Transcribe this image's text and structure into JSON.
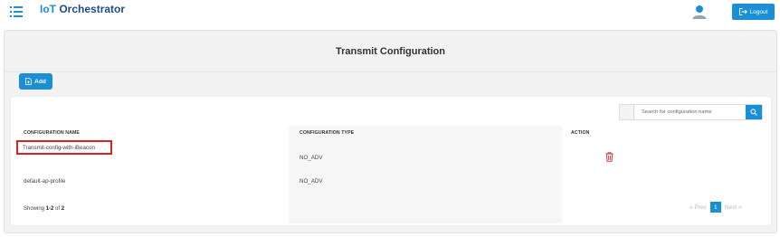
{
  "header": {
    "app_title_prefix": "IoT",
    "app_title_rest": "Orchestrator",
    "logout_label": "Logout"
  },
  "page": {
    "title": "Transmit Configuration",
    "add_label": "Add"
  },
  "search": {
    "placeholder": "Search for configuration name"
  },
  "table": {
    "columns": [
      "CONFIGURATION NAME",
      "CONFIGURATION TYPE",
      "ACTION"
    ],
    "rows": [
      {
        "name": "Transmit-config-with-iBeacon",
        "type": "NO_ADV"
      },
      {
        "name": "default-ap-profile",
        "type": "NO_ADV"
      }
    ]
  },
  "footer": {
    "showing_prefix": "Showing",
    "showing_range": "1-2",
    "showing_of": "of",
    "showing_total": "2"
  },
  "pagination": {
    "prev": "« Prev",
    "current_page": "1",
    "next": "Next »"
  },
  "colors": {
    "primary": "#1b8fd6",
    "title_dark": "#1b4e87",
    "highlight": "#d8231f"
  }
}
